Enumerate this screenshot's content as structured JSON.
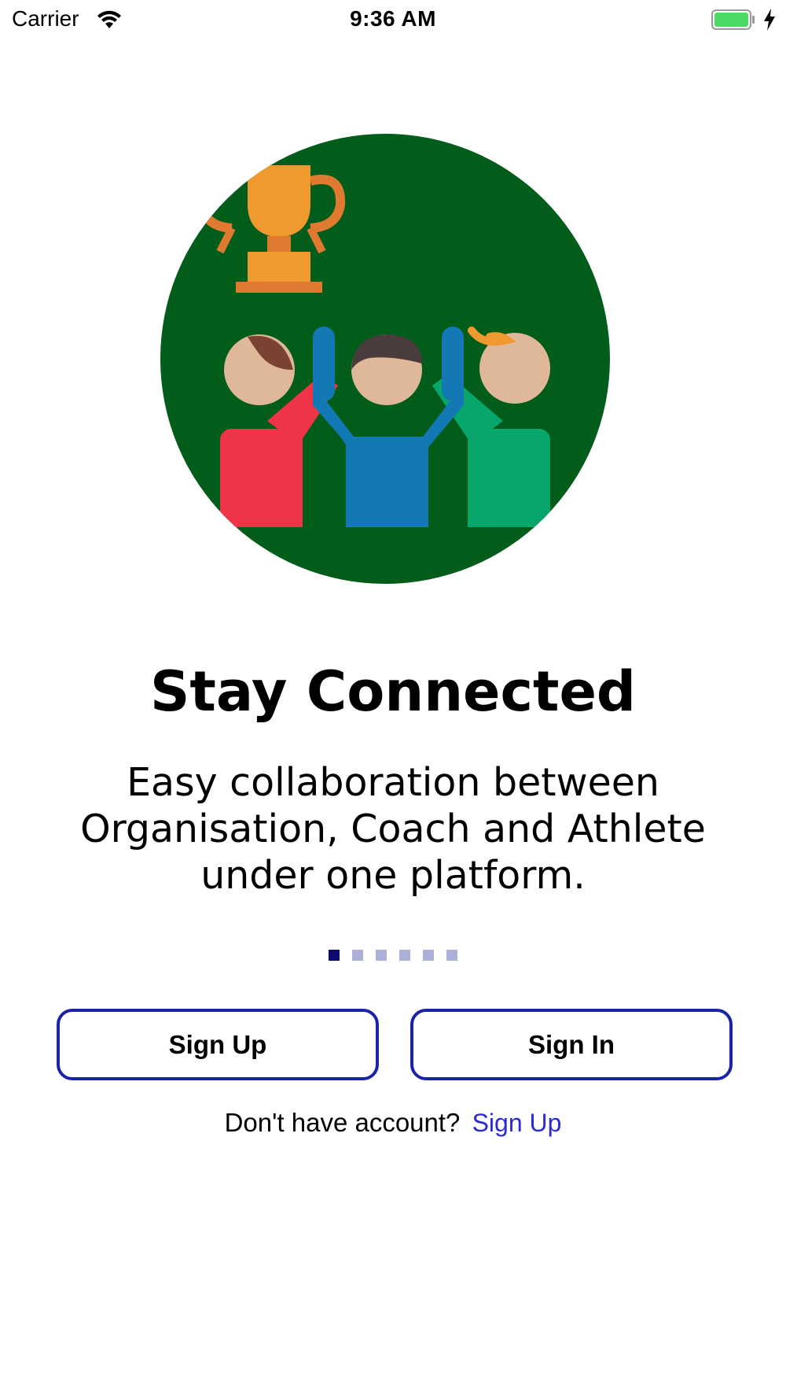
{
  "status_bar": {
    "carrier": "Carrier",
    "time": "9:36 AM"
  },
  "illustration": {
    "icon": "team-trophy-illustration",
    "background_color": "#025c1a"
  },
  "onboarding": {
    "title": "Stay Connected",
    "subtitle": "Easy collaboration between Organisation, Coach and Athlete under one platform.",
    "page_indicator": {
      "total": 6,
      "current": 1
    }
  },
  "buttons": {
    "sign_up_label": "Sign Up",
    "sign_in_label": "Sign In"
  },
  "footer": {
    "prompt": "Don't have account?",
    "link_label": "Sign Up"
  },
  "colors": {
    "accent": "#1a23a8",
    "link": "#2b2bd6",
    "indicator_active": "#0b0b6e",
    "indicator_inactive": "#aab0d8"
  }
}
